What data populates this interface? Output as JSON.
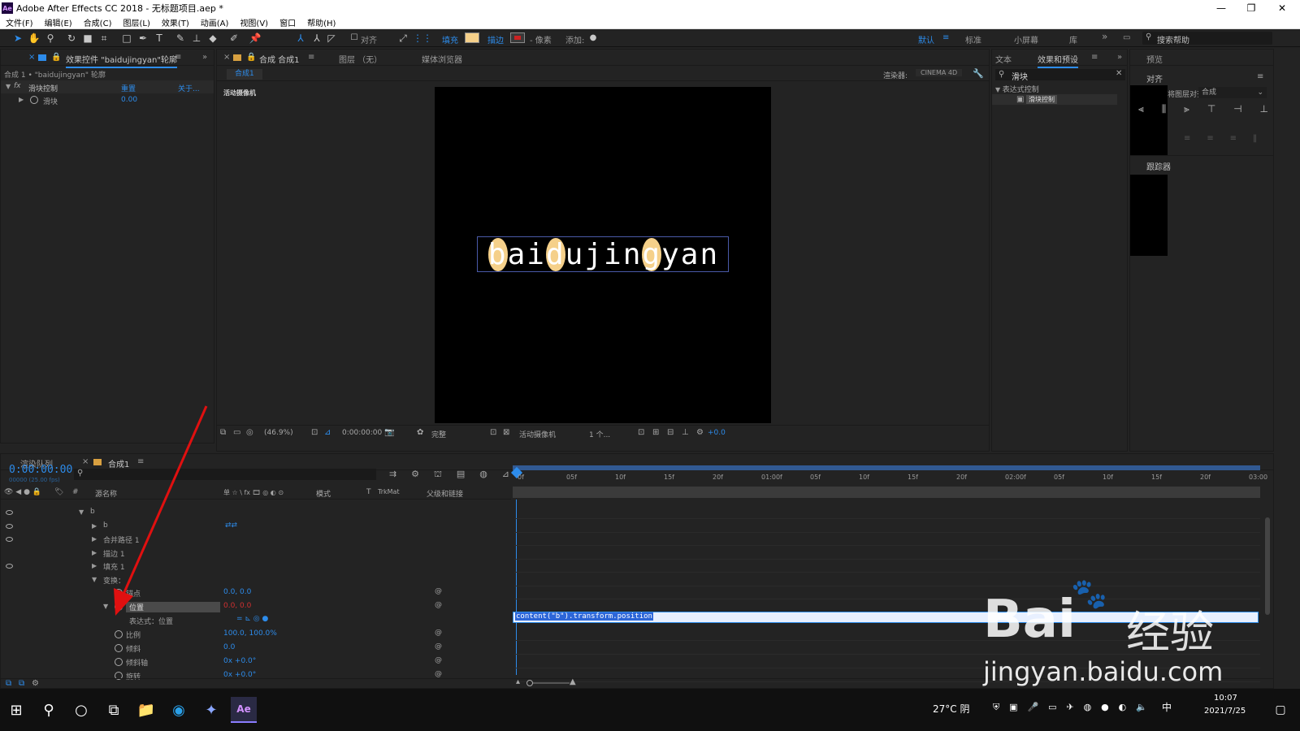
{
  "window": {
    "title": "Adobe After Effects CC 2018 - 无标题项目.aep *",
    "logo": "Ae",
    "controls": [
      "—",
      "❐",
      "✕"
    ]
  },
  "menu": [
    "文件(F)",
    "编辑(E)",
    "合成(C)",
    "图层(L)",
    "效果(T)",
    "动画(A)",
    "视图(V)",
    "窗口",
    "帮助(H)"
  ],
  "toolbar": {
    "align_label": "对齐",
    "fill_label": "填充",
    "fill_color": "#f5d08a",
    "stroke_label": "描边",
    "stroke_color": "#cc2222",
    "pixel_label": "- 像素",
    "add_label": "添加:",
    "workspaces": [
      "默认",
      "标准",
      "小屏幕",
      "库"
    ],
    "search_placeholder": "搜索帮助"
  },
  "effects_panel": {
    "tab_title": "效果控件 \"baidujingyan\"轮廓",
    "breadcrumb": "合成 1 • \"baidujingyan\" 轮廓",
    "effect_name": "滑块控制",
    "reset": "重置",
    "about": "关于...",
    "slider_label": "滑块",
    "slider_value": "0.00"
  },
  "comp_panel": {
    "tab_comp": "合成 合成1",
    "tab_layer": "图层 （无）",
    "tab_media": "媒体浏览器",
    "comp_chip": "合成1",
    "renderer_label": "渲染器:",
    "renderer_value": "CINEMA 4D",
    "camera_label": "活动摄像机",
    "text": "baidujingyan",
    "text_color": "#ffffff",
    "highlight_color": "#f5d08a",
    "footer": {
      "zoom": "(46.9%)",
      "time": "0:00:00:00",
      "quality": "完整",
      "camera": "活动摄像机",
      "views": "1 个...",
      "exposure": "+0.0"
    }
  },
  "right_panels": {
    "tab_text": "文本",
    "tab_effects": "效果和预设",
    "tab_preview": "预览",
    "search_value": "滑块",
    "tree_group": "表达式控制",
    "tree_item": "滑块控制",
    "align_title": "对齐",
    "align_to_label": "将图层对齐到:",
    "align_to_value": "合成",
    "tracker_title": "跟踪器"
  },
  "timeline": {
    "tab_render": "渲染队列",
    "tab_comp": "合成1",
    "time": "0:00:00:00",
    "fps": "00000 (25.00 fps)",
    "headers": {
      "layer_name": "源名称",
      "switches": "单 ☆ \\ fx 🎞 ◎ ◐ ⊙",
      "mode": "模式",
      "t": "T",
      "trkmat": "TrkMat",
      "parent": "父级和链接"
    },
    "ruler": [
      "0f",
      "05f",
      "10f",
      "15f",
      "20f",
      "01:00f",
      "05f",
      "10f",
      "15f",
      "20f",
      "02:00f",
      "05f",
      "10f",
      "15f",
      "20f",
      "03:00"
    ],
    "rows": [
      {
        "name": "b",
        "indent": 0,
        "twirl": "▼",
        "eye": true
      },
      {
        "name": "b",
        "indent": 1,
        "twirl": "▶",
        "eye": true
      },
      {
        "name": "合并路径 1",
        "indent": 1,
        "twirl": "▶",
        "eye": true
      },
      {
        "name": "描边 1",
        "indent": 1,
        "twirl": "▶",
        "eye": false
      },
      {
        "name": "填充 1",
        "indent": 1,
        "twirl": "▶",
        "eye": true
      },
      {
        "name": "变换：",
        "indent": 1,
        "twirl": "▼",
        "eye": false
      }
    ],
    "props": [
      {
        "name": "锚点",
        "value": "0.0, 0.0"
      },
      {
        "name": "位置",
        "value": "0.0, 0.0",
        "selected": true
      },
      {
        "name": "表达式：位置",
        "value": ""
      },
      {
        "name": "比例",
        "value": "100.0, 100.0%"
      },
      {
        "name": "倾斜",
        "value": "0.0"
      },
      {
        "name": "倾斜轴",
        "value": "0x +0.0°"
      },
      {
        "name": "旋转",
        "value": "0x +0.0°"
      }
    ],
    "expression": "content(\"b\").transform.position"
  },
  "watermark": {
    "brand": "Bai",
    "brand2": "经验",
    "url": "jingyan.baidu.com"
  },
  "taskbar": {
    "weather": "27°C 阴",
    "ime": "中",
    "time": "10:07",
    "date": "2021/7/25"
  }
}
